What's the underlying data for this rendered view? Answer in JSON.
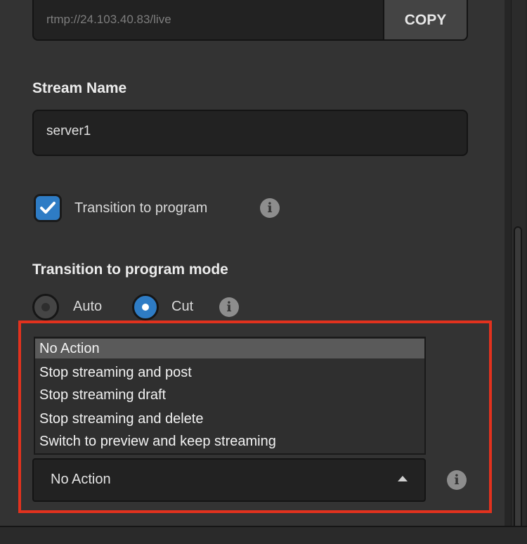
{
  "stream_url": {
    "value": "rtmp://24.103.40.83/live",
    "copy_label": "COPY"
  },
  "stream_name": {
    "label": "Stream Name",
    "value": "server1"
  },
  "transition_checkbox": {
    "label": "Transition to program",
    "checked": true
  },
  "transition_mode": {
    "label": "Transition to program mode",
    "options": [
      "Auto",
      "Cut"
    ],
    "selected": "Cut"
  },
  "end_action": {
    "options": [
      "No Action",
      "Stop streaming and post",
      "Stop streaming draft",
      "Stop streaming and delete",
      "Switch to preview and keep streaming"
    ],
    "highlighted": "No Action",
    "selected": "No Action"
  },
  "icons": {
    "info": "i"
  },
  "colors": {
    "accent": "#2e7cc5",
    "highlight_border": "#e2321e",
    "panel_bg": "#333333"
  }
}
